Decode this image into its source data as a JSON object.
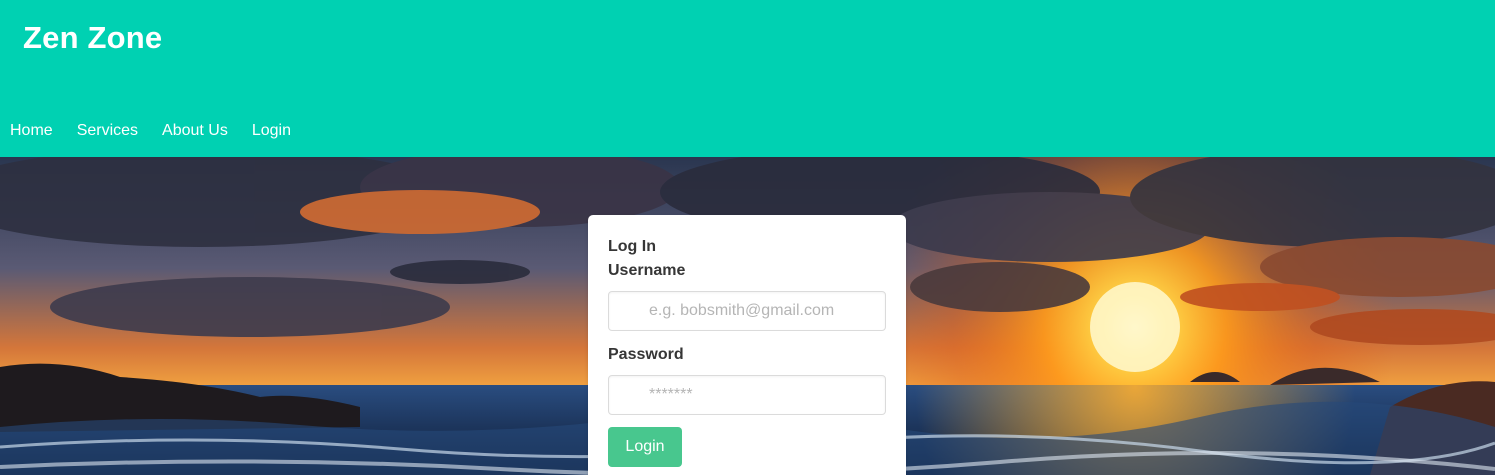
{
  "header": {
    "brand": "Zen Zone",
    "nav": [
      "Home",
      "Services",
      "About Us",
      "Login"
    ],
    "background_color": "#00d1b2"
  },
  "hero": {
    "image": "sunset-over-ocean"
  },
  "login_card": {
    "title": "Log In",
    "username_label": "Username",
    "username_placeholder": "e.g. bobsmith@gmail.com",
    "username_value": "",
    "password_label": "Password",
    "password_placeholder": "*******",
    "password_value": "",
    "submit_label": "Login",
    "submit_color": "#48c78e"
  }
}
